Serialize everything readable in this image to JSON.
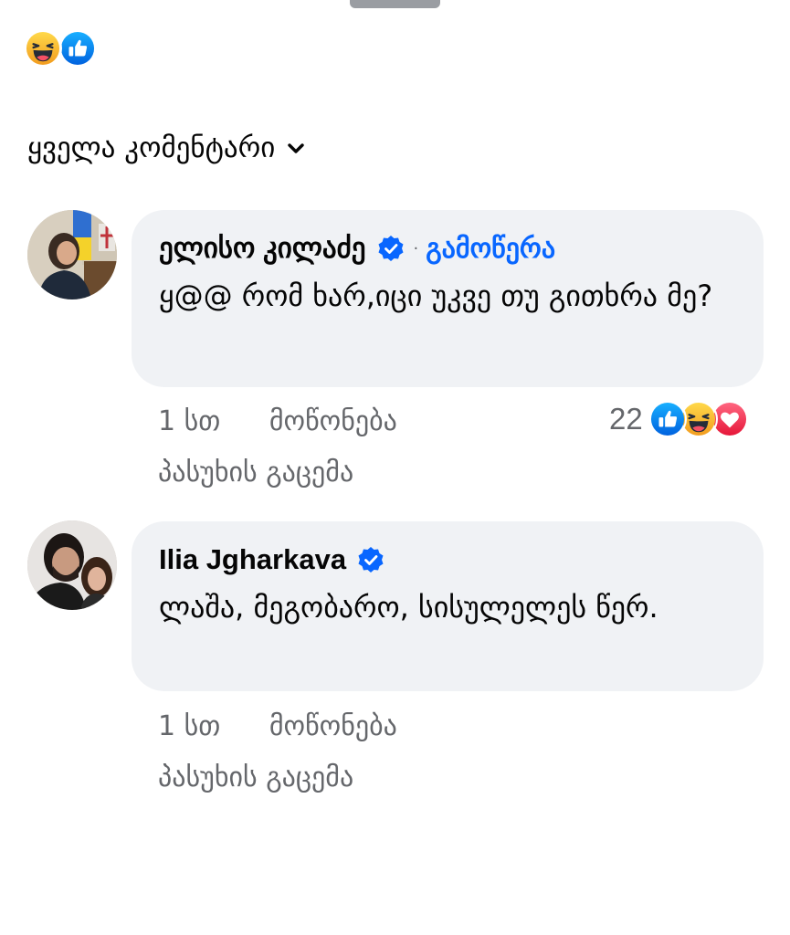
{
  "top_reactions": [
    "haha-icon",
    "like-icon"
  ],
  "filter": {
    "label": "ყველა კომენტარი",
    "icon": "chevron-down-icon"
  },
  "comments": [
    {
      "author": "ელისო კილაძე",
      "verified": true,
      "follow_label": "გამოწერა",
      "separator": "·",
      "text": "ყ@@ რომ ხარ,იცი უკვე თუ გითხრა მე?",
      "time": "1 სთ",
      "like_label": "მოწონება",
      "reply_label": "პასუხის გაცემა",
      "reaction_count": "22",
      "reactions": [
        "like-icon",
        "haha-icon",
        "love-icon"
      ]
    },
    {
      "author": "Ilia Jgharkava",
      "verified": true,
      "text": "ლაშა, მეგობარო, სისულელეს წერ.",
      "time": "1 სთ",
      "like_label": "მოწონება",
      "reply_label": "პასუხის გაცემა"
    }
  ],
  "colors": {
    "bubble": "#f0f2f5",
    "link_blue": "#0866ff",
    "meta_gray": "#65676b",
    "like_blue": "#1877f2",
    "love_red": "#f33e58",
    "haha_yellow": "#f7b125"
  }
}
